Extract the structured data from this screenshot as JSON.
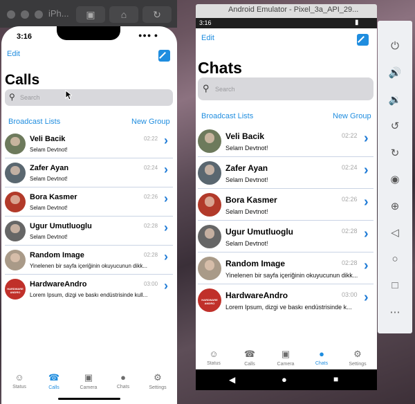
{
  "ios": {
    "window_title": "iPh...",
    "time": "3:16",
    "edit_label": "Edit",
    "heading": "Calls",
    "search_placeholder": "Search",
    "broadcast_label": "Broadcast Lists",
    "new_group_label": "New Group",
    "rows": [
      {
        "name": "Veli Bacik",
        "time": "02:22",
        "message": "Selam Devtnot!"
      },
      {
        "name": "Zafer Ayan",
        "time": "02:24",
        "message": "Selam Devtnot!"
      },
      {
        "name": "Bora Kasmer",
        "time": "02:26",
        "message": "Selam Devtnot!"
      },
      {
        "name": "Ugur Umutluoglu",
        "time": "02:28",
        "message": "Selam Devtnot!"
      },
      {
        "name": "Random Image",
        "time": "02:28",
        "message": "Yinelenen bir sayfa içeriğinin okuyucunun dikk..."
      },
      {
        "name": "HardwareAndro",
        "time": "03:00",
        "message": "Lorem Ipsum, dizgi ve baskı endüstrisinde kull..."
      }
    ],
    "tabs": [
      "Status",
      "Calls",
      "Camera",
      "Chats",
      "Settings"
    ],
    "active_tab": "Calls"
  },
  "android": {
    "window_title": "Android Emulator - Pixel_3a_API_29...",
    "time": "3:16",
    "edit_label": "Edit",
    "heading": "Chats",
    "search_placeholder": "Search",
    "broadcast_label": "Broadcast Lists",
    "new_group_label": "New Group",
    "rows": [
      {
        "name": "Veli Bacik",
        "time": "02:22",
        "message": "Selam Devtnot!"
      },
      {
        "name": "Zafer Ayan",
        "time": "02:24",
        "message": "Selam Devtnot!"
      },
      {
        "name": "Bora Kasmer",
        "time": "02:26",
        "message": "Selam Devtnot!"
      },
      {
        "name": "Ugur Umutluoglu",
        "time": "02:28",
        "message": "Selam Devtnot!"
      },
      {
        "name": "Random Image",
        "time": "02:28",
        "message": "Yinelenen bir sayfa içeriğinin okuyucunun dikk..."
      },
      {
        "name": "HardwareAndro",
        "time": "03:00",
        "message": "Lorem Ipsum, dizgi ve baskı endüstrisinde k..."
      }
    ],
    "tabs": [
      "Status",
      "Calls",
      "Camera",
      "Chats",
      "Settings"
    ],
    "active_tab": "Chats"
  },
  "avatar_badge": "HARDWARE ANDRO",
  "colors": {
    "accent": "#1f8ddf",
    "separator": "#c9d3e4",
    "search_bg": "#d8d8dc"
  }
}
